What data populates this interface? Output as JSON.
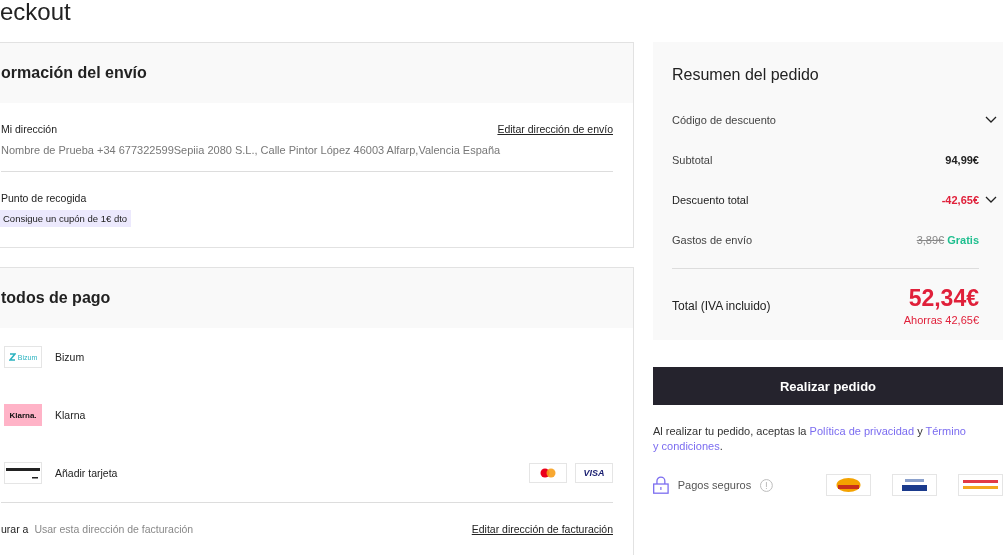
{
  "page_title": "eckout",
  "shipping": {
    "title": "ormación del envío",
    "address_label": "Mi dirección",
    "edit_link": "Editar dirección de envío",
    "address": "Nombre de Prueba +34 677322599Sepiia 2080 S.L., Calle Pintor López 46003 Alfarp,Valencia España",
    "pickup_label": "Punto de recogida",
    "coupon": "Consigue un cupón de 1€ dto"
  },
  "payment": {
    "title": "todos de pago",
    "methods": [
      {
        "kind": "bizum",
        "logo_text": "Bizum",
        "label": "Bizum"
      },
      {
        "kind": "klarna",
        "logo_text": "Klarna.",
        "label": "Klarna"
      },
      {
        "kind": "card",
        "label": "Añadir tarjeta",
        "brands": [
          {
            "kind": "mastercard"
          },
          {
            "kind": "visa",
            "text": "VISA"
          }
        ]
      }
    ],
    "billing_label": "urar a",
    "billing_value": "Usar esta dirección de facturación",
    "billing_edit": "Editar dirección de facturación"
  },
  "summary": {
    "title": "Resumen del pedido",
    "rows": [
      {
        "kind": "toggle",
        "label": "Código de descuento",
        "expanded": false
      },
      {
        "kind": "value",
        "label": "Subtotal",
        "value": "94,99€"
      },
      {
        "kind": "discount",
        "label": "Descuento total",
        "value": "-42,65€",
        "expanded": false
      },
      {
        "kind": "shipping",
        "label": "Gastos de envío",
        "old_value": "3,89€",
        "value": "Gratis"
      }
    ],
    "total_label": "Total (IVA incluido)",
    "total": "52,34€",
    "savings": "Ahorras 42,65€"
  },
  "order_button": "Realizar pedido",
  "terms": {
    "prefix": "Al realizar tu pedido, aceptas la ",
    "privacy_link": "Política de privacidad",
    "middle": " y ",
    "terms_link_1": "Término",
    "terms_link_2": "y condiciones",
    "suffix": "."
  },
  "secure": {
    "label": "Pagos seguros",
    "badges": [
      {
        "kind": "safekey"
      },
      {
        "kind": "verified-visa"
      },
      {
        "kind": "mastercard-securecode"
      }
    ]
  }
}
